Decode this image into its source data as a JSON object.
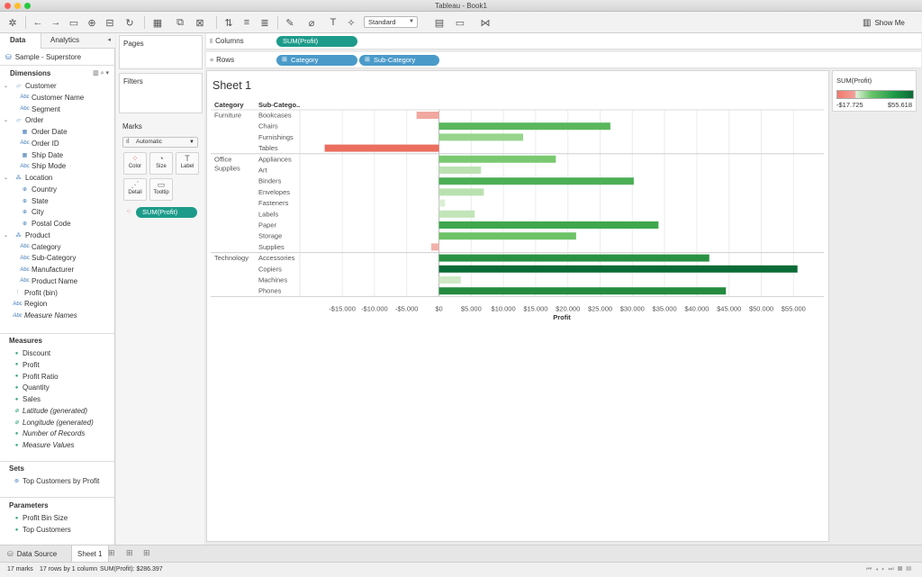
{
  "window": {
    "title": "Tableau - Book1"
  },
  "toolbar": {
    "mark_size_select": "Standard",
    "show_me_label": "Show Me"
  },
  "datapane": {
    "tabs": [
      "Data",
      "Analytics"
    ],
    "datasource": "Sample - Superstore",
    "dimensions_header": "Dimensions",
    "measures_header": "Measures",
    "sets_header": "Sets",
    "parameters_header": "Parameters",
    "dimensions": [
      {
        "label": "Customer",
        "kind": "folder"
      },
      {
        "label": "Customer Name",
        "kind": "abc"
      },
      {
        "label": "Segment",
        "kind": "abc"
      },
      {
        "label": "Order",
        "kind": "folder"
      },
      {
        "label": "Order Date",
        "kind": "date"
      },
      {
        "label": "Order ID",
        "kind": "abc"
      },
      {
        "label": "Ship Date",
        "kind": "date"
      },
      {
        "label": "Ship Mode",
        "kind": "abc"
      },
      {
        "label": "Location",
        "kind": "hierarchy"
      },
      {
        "label": "Country",
        "kind": "geo"
      },
      {
        "label": "State",
        "kind": "geo"
      },
      {
        "label": "City",
        "kind": "geo"
      },
      {
        "label": "Postal Code",
        "kind": "geo"
      },
      {
        "label": "Product",
        "kind": "hierarchy"
      },
      {
        "label": "Category",
        "kind": "abc"
      },
      {
        "label": "Sub-Category",
        "kind": "abc"
      },
      {
        "label": "Manufacturer",
        "kind": "abc"
      },
      {
        "label": "Product Name",
        "kind": "abc"
      },
      {
        "label": "Profit (bin)",
        "kind": "bin"
      },
      {
        "label": "Region",
        "kind": "abc"
      },
      {
        "label": "Measure Names",
        "kind": "abc"
      }
    ],
    "measures": [
      "Discount",
      "Profit",
      "Profit Ratio",
      "Quantity",
      "Sales",
      "Latitude (generated)",
      "Longitude (generated)",
      "Number of Records",
      "Measure Values"
    ],
    "sets": [
      "Top Customers by Profit"
    ],
    "parameters": [
      "Profit Bin Size",
      "Top Customers"
    ]
  },
  "cards": {
    "pages_title": "Pages",
    "filters_title": "Filters",
    "marks_title": "Marks",
    "marks_type": "Automatic",
    "mark_buttons": [
      "Color",
      "Size",
      "Label",
      "Detail",
      "Tooltip"
    ],
    "marks_pill": "SUM(Profit)"
  },
  "shelves": {
    "columns_label": "Columns",
    "rows_label": "Rows",
    "columns_pills": [
      "SUM(Profit)"
    ],
    "rows_pills": [
      "Category",
      "Sub-Category"
    ]
  },
  "legend": {
    "title": "SUM(Profit)",
    "min": "-$17.725",
    "max": "$55.618"
  },
  "sheet": {
    "title": "Sheet 1",
    "header_category": "Category",
    "header_subcategory": "Sub-Catego..",
    "xlabel": "Profit"
  },
  "chart_data": {
    "type": "bar",
    "orientation": "horizontal",
    "title": "Sheet 1",
    "xlabel": "Profit",
    "xlim": [
      -17725,
      55618
    ],
    "xticks": [
      -15000,
      -10000,
      -5000,
      0,
      5000,
      10000,
      15000,
      20000,
      25000,
      30000,
      35000,
      40000,
      45000,
      50000,
      55000
    ],
    "tick_labels": [
      "-$15.000",
      "-$10.000",
      "-$5.000",
      "$0",
      "$5.000",
      "$10.000",
      "$15.000",
      "$20.000",
      "$25.000",
      "$30.000",
      "$35.000",
      "$40.000",
      "$45.000",
      "$50.000",
      "$55.000"
    ],
    "groups": [
      {
        "category": "Furniture",
        "rows": [
          {
            "sub": "Bookcases",
            "value": -3473
          },
          {
            "sub": "Chairs",
            "value": 26590
          },
          {
            "sub": "Furnishings",
            "value": 13059
          },
          {
            "sub": "Tables",
            "value": -17725
          }
        ]
      },
      {
        "category": "Office Supplies",
        "rows": [
          {
            "sub": "Appliances",
            "value": 18138
          },
          {
            "sub": "Art",
            "value": 6528
          },
          {
            "sub": "Binders",
            "value": 30222
          },
          {
            "sub": "Envelopes",
            "value": 6964
          },
          {
            "sub": "Fasteners",
            "value": 950
          },
          {
            "sub": "Labels",
            "value": 5546
          },
          {
            "sub": "Paper",
            "value": 34054
          },
          {
            "sub": "Storage",
            "value": 21279
          },
          {
            "sub": "Supplies",
            "value": -1189
          }
        ]
      },
      {
        "category": "Technology",
        "rows": [
          {
            "sub": "Accessories",
            "value": 41937
          },
          {
            "sub": "Copiers",
            "value": 55618
          },
          {
            "sub": "Machines",
            "value": 3385
          },
          {
            "sub": "Phones",
            "value": 44516
          }
        ]
      }
    ]
  },
  "tabs": {
    "data_source": "Data Source",
    "sheet": "Sheet 1"
  },
  "status": {
    "marks": "17 marks",
    "rows": "17 rows by 1 column",
    "sum": "SUM(Profit): $286.397"
  }
}
